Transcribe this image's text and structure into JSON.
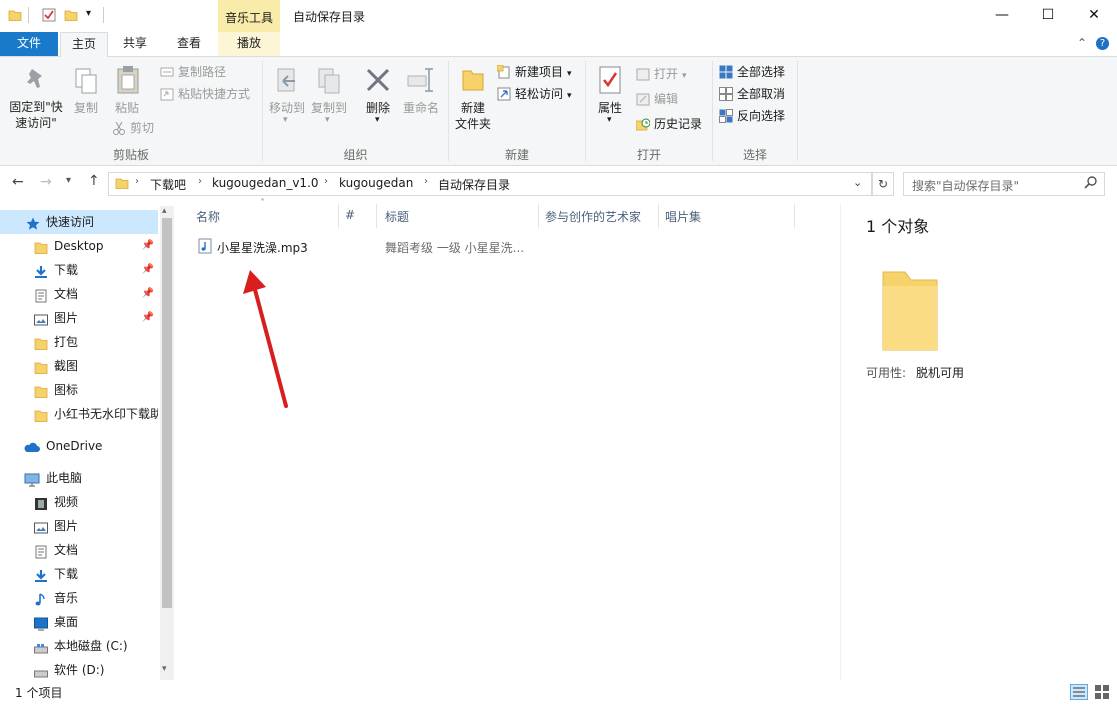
{
  "titlebar": {
    "contextual_tab": "音乐工具",
    "window_title": "自动保存目录",
    "minimize": "—",
    "maximize": "☐",
    "close": "✕"
  },
  "ribbon_tabs": {
    "file": "文件",
    "home": "主页",
    "share": "共享",
    "view": "查看",
    "play": "播放",
    "collapse": "⌃",
    "help": "?"
  },
  "ribbon": {
    "clipboard": {
      "pin_quick_access": "固定到\"快\n速访问\"",
      "copy": "复制",
      "paste": "粘贴",
      "copy_path": "复制路径",
      "paste_shortcut": "粘贴快捷方式",
      "cut": "剪切",
      "group": "剪贴板"
    },
    "organize": {
      "move_to": "移动到",
      "copy_to": "复制到",
      "delete": "删除",
      "rename": "重命名",
      "group": "组织"
    },
    "new": {
      "new_folder": "新建\n文件夹",
      "new_item": "新建项目",
      "easy_access": "轻松访问",
      "group": "新建"
    },
    "open": {
      "properties": "属性",
      "open": "打开",
      "edit": "编辑",
      "history": "历史记录",
      "group": "打开"
    },
    "select": {
      "select_all": "全部选择",
      "select_none": "全部取消",
      "invert": "反向选择",
      "group": "选择"
    }
  },
  "address": {
    "crumbs": [
      "下载吧",
      "kugougedan_v1.0",
      "kugougedan",
      "自动保存目录"
    ],
    "search_placeholder": "搜索\"自动保存目录\""
  },
  "nav": {
    "quick_access": "快速访问",
    "quick_items": [
      {
        "label": "Desktop",
        "pinned": true
      },
      {
        "label": "下载",
        "pinned": true
      },
      {
        "label": "文档",
        "pinned": true
      },
      {
        "label": "图片",
        "pinned": true
      },
      {
        "label": "打包",
        "pinned": false
      },
      {
        "label": "截图",
        "pinned": false
      },
      {
        "label": "图标",
        "pinned": false
      },
      {
        "label": "小红书无水印下载助",
        "pinned": false
      }
    ],
    "onedrive": "OneDrive",
    "this_pc": "此电脑",
    "pc_items": [
      "视频",
      "图片",
      "文档",
      "下载",
      "音乐",
      "桌面",
      "本地磁盘 (C:)",
      "软件 (D:)"
    ]
  },
  "file_list": {
    "columns": [
      "名称",
      "#",
      "标题",
      "参与创作的艺术家",
      "唱片集"
    ],
    "rows": [
      {
        "name": "小星星洗澡.mp3",
        "number": "",
        "title": "舞蹈考级 一级 小星星洗...",
        "artist": "",
        "album": ""
      }
    ]
  },
  "details_pane": {
    "count": "1 个对象",
    "availability_label": "可用性:",
    "availability_value": "脱机可用"
  },
  "status": {
    "count": "1 个项目"
  },
  "colors": {
    "file_tab": "#1979ca",
    "contextual": "#f9ecaa",
    "folder": "#f6d26b",
    "arrow": "#d81e1e"
  }
}
